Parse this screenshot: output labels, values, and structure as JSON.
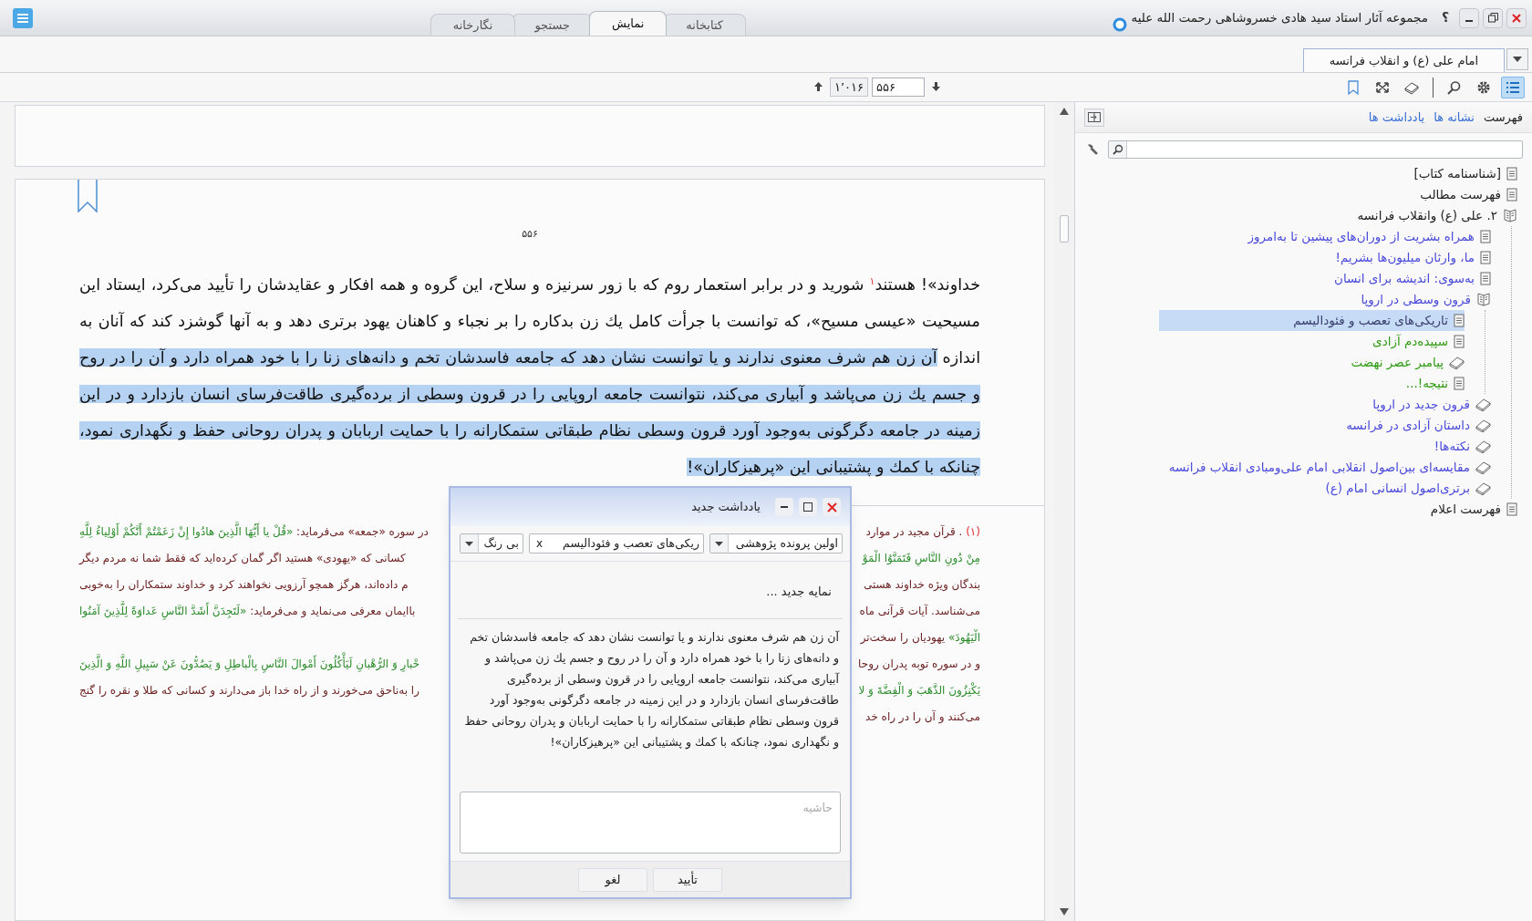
{
  "window": {
    "title": "مجموعه آثار استاد سید هادی خسروشاهی رحمت الله علیه",
    "help_glyph": "؟"
  },
  "main_tabs": [
    {
      "label": "کتابخانه",
      "selected": false
    },
    {
      "label": "نمایش",
      "selected": true
    },
    {
      "label": "جستجو",
      "selected": false
    },
    {
      "label": "نگارخانه",
      "selected": false
    }
  ],
  "document_tabs": [
    {
      "label": "امام علی (ع) و انقلاب فرانسه",
      "selected": true
    }
  ],
  "toolbar": {
    "tools": [
      {
        "kind": "list",
        "selected": true
      },
      {
        "kind": "settings",
        "selected": false
      },
      {
        "kind": "search",
        "selected": false
      },
      {
        "kind": "separator"
      },
      {
        "kind": "layers",
        "selected": false
      },
      {
        "kind": "fit",
        "selected": false
      },
      {
        "kind": "bookmark",
        "selected": false
      }
    ],
    "page_nav": {
      "current": "۵۵۶",
      "total": "۱٬۰۱۶"
    }
  },
  "sidebar": {
    "tabs": [
      {
        "label": "فهرست",
        "selected": true
      },
      {
        "label": "نشانه ها",
        "selected": false
      },
      {
        "label": "یادداشت ها",
        "selected": false
      }
    ],
    "tree": [
      {
        "label": "[شناسنامه کتاب]",
        "kind": "page",
        "color": "#222222",
        "selected": false
      },
      {
        "label": "فهرست مطالب",
        "kind": "page",
        "color": "#222222",
        "selected": false
      },
      {
        "label": "۲. علی (ع) وانقلاب فرانسه",
        "kind": "open-book",
        "color": "#222222",
        "selected": false,
        "children": [
          {
            "label": "همراه بشریت از دوران‌های پیشین تا به‌امروز",
            "kind": "page",
            "color": "#4b4bdc",
            "selected": false
          },
          {
            "label": "ما، وارثان میلیون‌ها بشریم!",
            "kind": "page",
            "color": "#4b4bdc",
            "selected": false
          },
          {
            "label": "به‌سوی: اندیشه برای انسان",
            "kind": "page",
            "color": "#4b4bdc",
            "selected": false
          },
          {
            "label": "قرون وسطی در اروپا",
            "kind": "open-book",
            "color": "#4b4bdc",
            "selected": false,
            "children": [
              {
                "label": "تاریکی‌های تعصب و فئوداليسم",
                "kind": "page",
                "color": "#3a3f6e",
                "selected": true
              },
              {
                "label": "سپیده‌دم آزادی",
                "kind": "page",
                "color": "#2f9a12",
                "selected": false
              },
              {
                "label": "پیامبر عصر نهضت",
                "kind": "book",
                "color": "#2f9a12",
                "selected": false
              },
              {
                "label": "نتیجه!...",
                "kind": "page",
                "color": "#2f9a12",
                "selected": false
              }
            ]
          },
          {
            "label": "قرون جدید در اروپا",
            "kind": "book",
            "color": "#4b4bdc",
            "selected": false
          },
          {
            "label": "داستان آزادی در فرانسه",
            "kind": "book",
            "color": "#4b4bdc",
            "selected": false
          },
          {
            "label": "نکته‌ها!",
            "kind": "book",
            "color": "#4b4bdc",
            "selected": false
          },
          {
            "label": "مقایسه‌ای بین‌اصول انقلابی امام علی‌ومبادی انقلاب فرانسه",
            "kind": "book",
            "color": "#4b4bdc",
            "selected": false
          },
          {
            "label": "برتری‌اصول انسانی امام (ع)",
            "kind": "book",
            "color": "#4b4bdc",
            "selected": false
          }
        ]
      },
      {
        "label": "فهرست اعلام",
        "kind": "page",
        "color": "#222222",
        "selected": false
      }
    ]
  },
  "document": {
    "page_number": "۵۵۶",
    "paragraph": {
      "text": "خداوند»! هستند$^{۱}$ شورید و در برابر استعمار روم که با زور سرنیزه و سلاح، این گروه و همه افکار و عقایدشان را تأیید می‌کرد، ایستاد این مسیحیت «عیسی مسیح»، که توانست با جرأت کامل يك زن بدکاره را بر نجباء و کاهنان یهود برتری دهد و به آنها گوشزد کند که آنان به اندازه ",
      "selected_text": "آن زن هم شرف معنوی ندارند و یا توانست نشان دهد که جامعه فاسدشان تخم و دانه‌های زنا را با خود همراه دارد و آن را در روح و جسم يك زن می‌پاشد و آبیاری می‌کند، نتوانست جامعه اروپایی را در قرون وسطی از برده‌گیری طاقت‌فرسای انسان بازدارد و در این زمینه در جامعه دگرگونی به‌وجود آورد قرون وسطی نظام طبقاتی ستمکارانه را با حمایت اربابان و پدران روحانی حفظ و نگهداری نمود، چنانکه با کمك و پشتیبانی این «پرهیزکاران»!"
    },
    "footnote_lines": [
      {
        "right": [
          {
            "text": "(۱)",
            "kind": "number"
          },
          {
            "text": " . قرآن مجید در موارد",
            "kind": "prose"
          }
        ],
        "left": [
          {
            "text": "در سوره «جمعه» می‌فرماید: ",
            "kind": "prose"
          },
          {
            "text": "«قُلْ يا أَيُّهَا الَّذِينَ هادُوا إِنْ زَعَمْتُمْ أَنَّكُمْ أَوْلِياءُ لِلَّهِ",
            "kind": "verse"
          }
        ]
      },
      {
        "right": [
          {
            "text": "مِنْ دُونِ النَّاسِ فَتَمَنَّوُا الْمَوْ",
            "kind": "verse"
          }
        ],
        "left": [
          {
            "text": "کسانی که «یهودی» هستید اگر گمان کرده‌اید که فقط شما نه مردم دیگر",
            "kind": "prose"
          }
        ]
      },
      {
        "right": [
          {
            "text": "بندگان ویژه خداوند هستی",
            "kind": "prose"
          }
        ],
        "left": [
          {
            "text": "م داده‌اند، هرگز همچو آرزویی نخواهند کرد و خداوند ستمکاران را به‌خوبی",
            "kind": "prose"
          }
        ]
      },
      {
        "right": [
          {
            "text": "می‌شناسد. آیات قرآنی ماه",
            "kind": "prose"
          }
        ],
        "left": [
          {
            "text": "باایمان معرفی می‌نماید و می‌فرماید: ",
            "kind": "prose"
          },
          {
            "text": "«لَتَجِدَنَّ أَشَدَّ النَّاسِ عَداوَةً لِلَّذِينَ آمَنُوا",
            "kind": "verse"
          }
        ]
      },
      {
        "right": [
          {
            "text": "الْيَهُودَ»",
            "kind": "verse"
          },
          {
            "text": " یهودیان را سخت‌تر",
            "kind": "prose"
          }
        ]
      },
      {
        "right": [
          {
            "text": "و در سوره توبه پدران روحا",
            "kind": "prose"
          }
        ],
        "left": [
          {
            "text": "حْبارِ وَ الرُّهْبانِ لَيَأْكُلُونَ أَمْوالَ النَّاسِ بِالْباطِلِ وَ يَصُدُّونَ عَنْ سَبِيلِ اللَّهِ وَ الَّذِينَ",
            "kind": "verse"
          }
        ]
      },
      {
        "right": [
          {
            "text": "يَكْنِزُونَ الذَّهَبَ وَ الْفِضَّةَ وَ لا",
            "kind": "verse"
          }
        ],
        "left": [
          {
            "text": "را به‌ناحق می‌خورند و از راه خدا باز می‌دارند و کسانی که طلا و نقره را گنج",
            "kind": "prose"
          }
        ]
      },
      {
        "right": [
          {
            "text": "می‌کنند و آن را در راه خد",
            "kind": "prose"
          }
        ]
      }
    ]
  },
  "dialog": {
    "title": "یادداشت جدید",
    "project": "اولین پرونده پژوهشی",
    "tag": "ریکی‌های تعصب و فئوداليسم",
    "tag_remove_glyph": "x",
    "color_choice": "بی رنگ",
    "new_index": "نمایه جدید ...",
    "quote": "آن زن هم شرف معنوی ندارند و یا توانست نشان دهد که جامعه فاسدشان تخم و دانه‌های زنا را با خود همراه دارد و آن را در روح و جسم يك زن می‌پاشد و آبیاری می‌کند، نتوانست جامعه اروپایی را در قرون وسطی از برده‌گیری طاقت‌فرسای انسان بازدارد و در این زمینه در جامعه دگرگونی به‌وجود آورد قرون وسطی نظام طبقاتی ستمکارانه را با حمایت اربابان و پدران روحانی حفظ و نگهداری نمود، چنانکه با کمك و پشتیبانی این «پرهیزکاران»!",
    "margin_field": {
      "placeholder": "حاشیه"
    },
    "buttons": [
      "تأیید",
      "لغو"
    ]
  }
}
